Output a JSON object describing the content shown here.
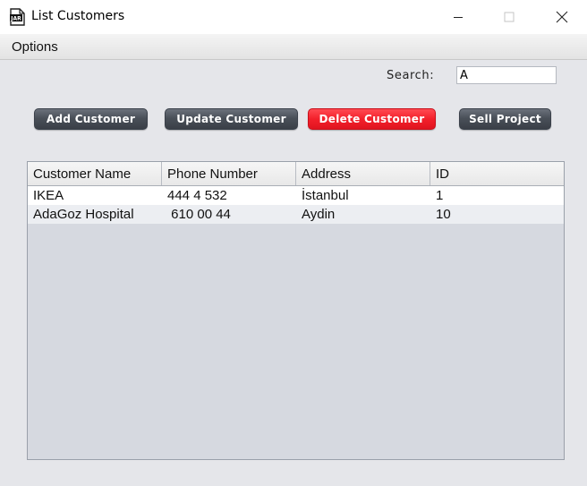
{
  "window": {
    "title": "List Customers",
    "icon": "jar-file-icon"
  },
  "menu": {
    "items": [
      "Options"
    ]
  },
  "search": {
    "label": "Search:",
    "value": "A"
  },
  "buttons": {
    "add": "Add Customer",
    "update": "Update Customer",
    "delete": "Delete Customer",
    "sell": "Sell Project"
  },
  "colors": {
    "delete_button": "#f3202b",
    "dark_button": "#4a5059"
  },
  "table": {
    "columns": [
      "Customer Name",
      "Phone Number",
      "Address",
      "ID"
    ],
    "rows": [
      [
        "IKEA",
        "444 4 532",
        "İstanbul",
        "1"
      ],
      [
        "AdaGoz Hospital",
        " 610 00 44",
        "Aydin",
        "10"
      ]
    ]
  }
}
